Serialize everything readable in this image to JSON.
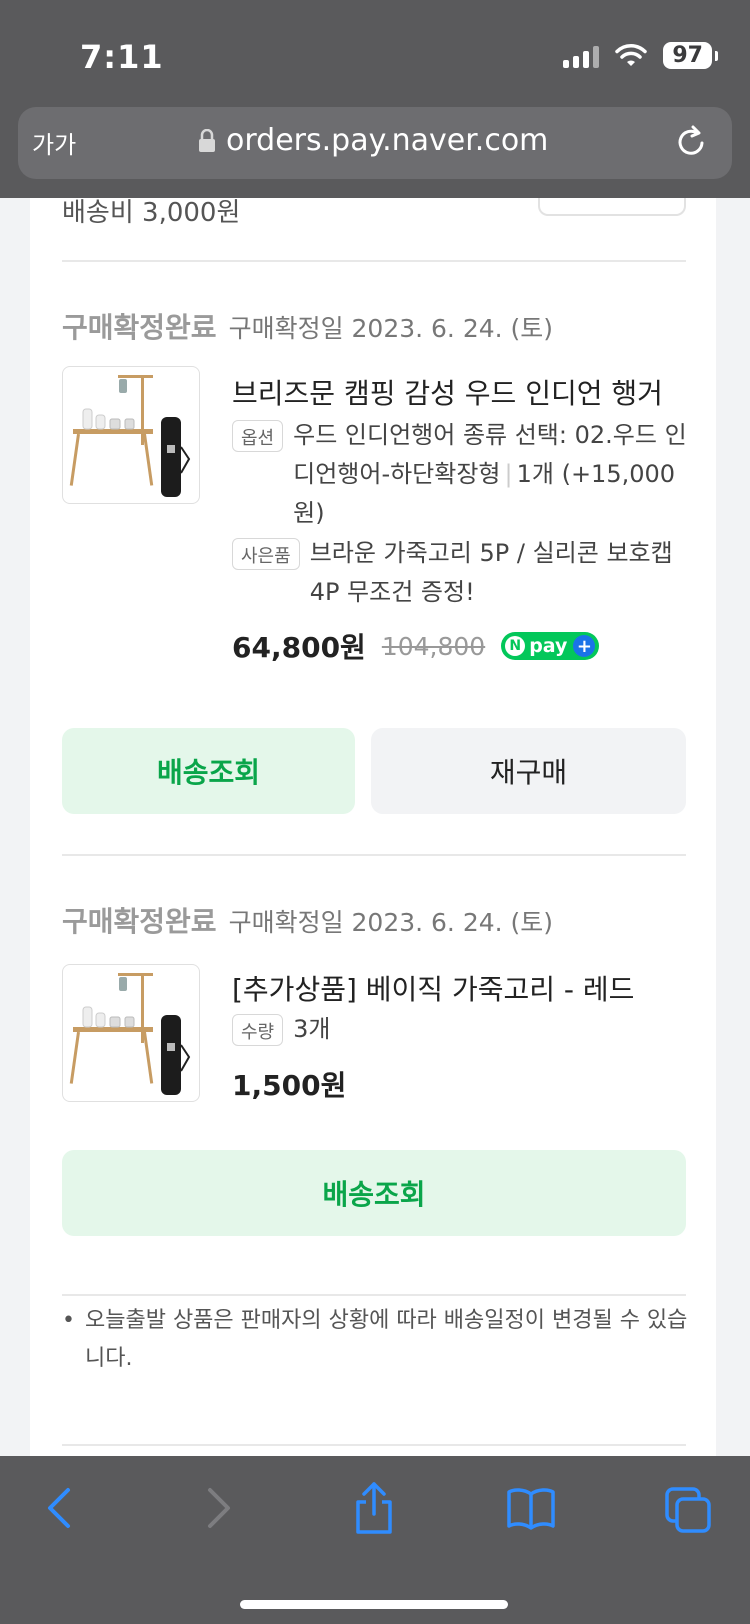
{
  "status_bar": {
    "time": "7:11",
    "battery": "97"
  },
  "browser": {
    "aa_label": "가가",
    "url": "orders.pay.naver.com"
  },
  "shipping_fee": "배송비 3,000원",
  "orders": [
    {
      "status": "구매확정완료",
      "confirm_date": "구매확정일 2023. 6. 24. (토)",
      "title": "브리즈문 캠핑 감성 우드 인디언 행거",
      "option_tag": "옵션",
      "option_text": "우드 인디언행어 종류 선택: 02.우드 인디언행어-하단확장형",
      "option_qty": "1개 (+15,000원)",
      "gift_tag": "사은품",
      "gift_text": "브라운 가죽고리 5P / 실리콘 보호캡 4P 무조건 증정!",
      "price": "64,800원",
      "original_price": "104,800",
      "npay_label": "pay",
      "track_button": "배송조회",
      "rebuy_button": "재구매"
    },
    {
      "status": "구매확정완료",
      "confirm_date": "구매확정일 2023. 6. 24. (토)",
      "title": "[추가상품] 베이직 가죽고리 - 레드",
      "qty_tag": "수량",
      "qty": "3개",
      "price": "1,500원",
      "track_button": "배송조회"
    }
  ],
  "notice": "오늘출발 상품은 판매자의 상황에 따라 배송일정이 변경될 수 있습니다."
}
